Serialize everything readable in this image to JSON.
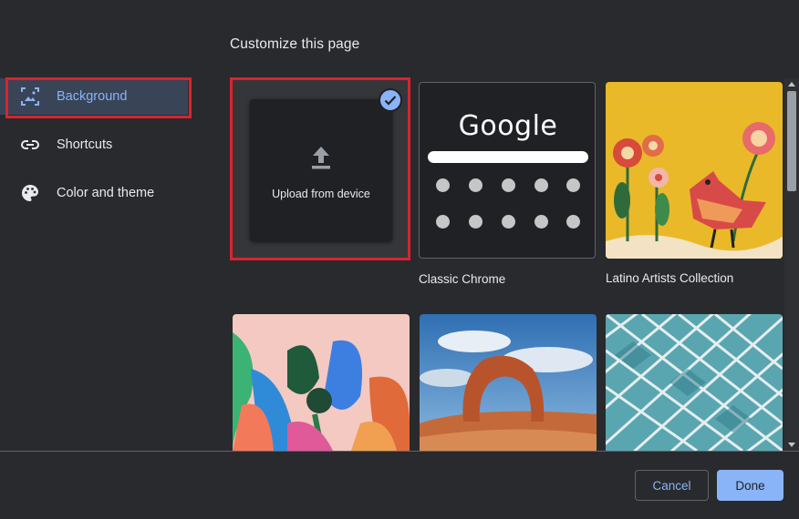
{
  "dialog": {
    "title": "Customize this page"
  },
  "sidebar": {
    "items": [
      {
        "label": "Background",
        "icon": "background-image-icon",
        "active": true
      },
      {
        "label": "Shortcuts",
        "icon": "link-icon",
        "active": false
      },
      {
        "label": "Color and theme",
        "icon": "palette-icon",
        "active": false
      }
    ]
  },
  "backgrounds": {
    "upload_label": "Upload from device",
    "classic": {
      "label": "Classic Chrome",
      "logo_text": "Google"
    },
    "latino": {
      "label": "Latino Artists Collection"
    }
  },
  "footer": {
    "cancel_label": "Cancel",
    "done_label": "Done"
  },
  "colors": {
    "accent": "#8ab4f8",
    "background": "#292a2d",
    "highlight_border": "#d9232e",
    "active_nav_bg": "#394457"
  }
}
